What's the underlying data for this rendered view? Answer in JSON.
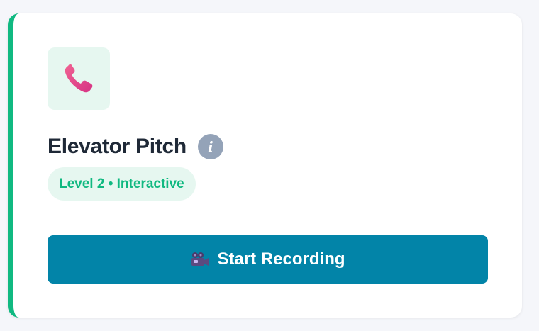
{
  "card": {
    "icon": "telephone-receiver-icon",
    "title": "Elevator Pitch",
    "info_icon_glyph": "i",
    "badge": "Level 2 • Interactive",
    "button": {
      "icon": "movie-camera-icon",
      "label": "Start Recording"
    }
  },
  "colors": {
    "accent": "#10b981",
    "accent_bg": "#e6f7f0",
    "button": "#0284a8",
    "title": "#1f2937",
    "info_icon": "#94a3b8",
    "phone_icon": "#e84393"
  }
}
